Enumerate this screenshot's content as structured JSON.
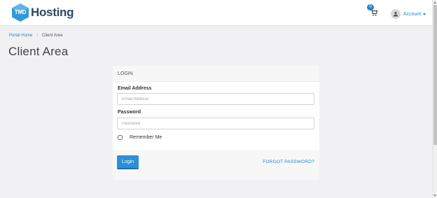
{
  "brand": {
    "logo_mark": "TMD",
    "logo_text": "Hosting",
    "logo_color": "#2c4861",
    "accent": "#1e88c7"
  },
  "header": {
    "cart_icon": "shopping-cart-icon",
    "cart_count": "0",
    "account_icon": "user-icon",
    "account_label": "Account"
  },
  "breadcrumb": {
    "home": "Portal Home",
    "separator": "/",
    "current": "Client Area"
  },
  "page_title": "Client Area",
  "login_panel": {
    "heading": "LOGIN",
    "email_label": "Email Address",
    "email_placeholder": "Email Address",
    "email_value": "",
    "password_label": "Password",
    "password_placeholder": "Password",
    "password_value": "",
    "remember_label": "Remember Me",
    "remember_checked": false,
    "login_button": "Login",
    "forgot_link": "FORGOT PASSWORD?"
  }
}
